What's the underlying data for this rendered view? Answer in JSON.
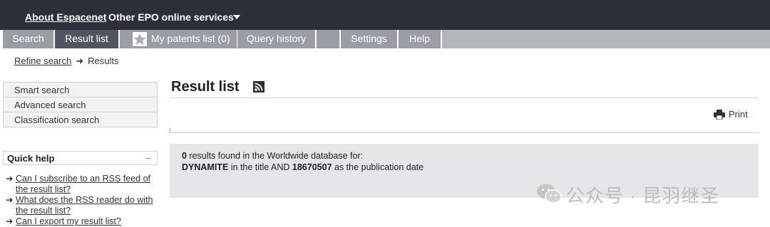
{
  "topbar": {
    "about_label": "About Espacenet",
    "other_label": "Other EPO online services"
  },
  "tabs": {
    "search": "Search",
    "result_list": "Result list",
    "my_patents": "My patents list (0)",
    "query_history": "Query history",
    "settings": "Settings",
    "help": "Help"
  },
  "breadcrumb": {
    "refine": "Refine search",
    "arrow": "➜",
    "current": "Results"
  },
  "leftnav": {
    "items": [
      "Smart search",
      "Advanced search",
      "Classification search"
    ]
  },
  "quick_help": {
    "title": "Quick help",
    "collapse": "–",
    "items": [
      "Can I subscribe to an RSS feed of the result list?",
      "What does the RSS reader do with the result list?",
      "Can I export my result list?"
    ]
  },
  "main": {
    "title": "Result list",
    "print_label": "Print",
    "results": {
      "count": "0",
      "line1_rest": " results found in the Worldwide database for:",
      "term": "DYNAMITE",
      "mid": " in the title AND ",
      "date": "18670507",
      "end": " as the publication date"
    }
  },
  "watermark": {
    "text": "公众号 · 昆羽继圣"
  },
  "colors": {
    "topbar": "#2b2f38",
    "tab": "#9a9ea4",
    "tab_active": "#50565f",
    "results_bg": "#e5e6e8"
  }
}
